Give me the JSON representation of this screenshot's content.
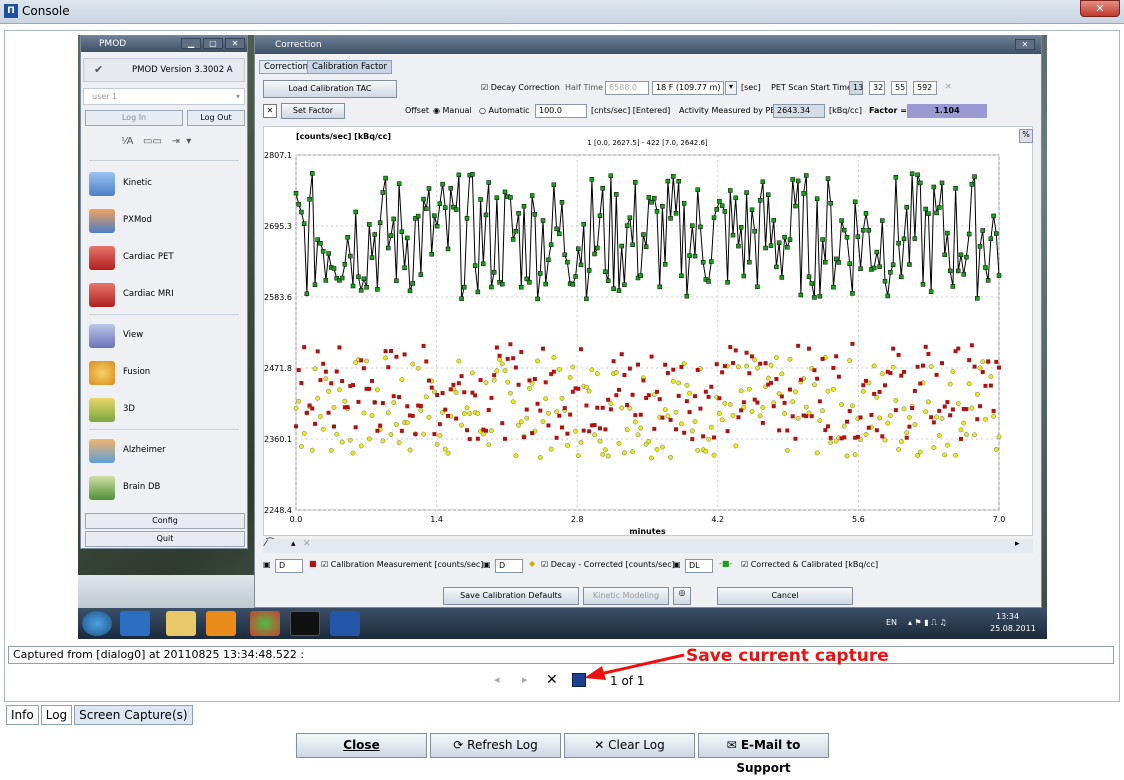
{
  "window": {
    "title": "Console"
  },
  "pmod": {
    "title": "PMOD",
    "version": "PMOD Version 3.3002 A",
    "user_placeholder": "user 1",
    "login": "Log In",
    "logout": "Log Out",
    "tools": [
      "Kinetic",
      "PXMod",
      "Cardiac PET",
      "Cardiac MRI",
      "View",
      "Fusion",
      "3D",
      "Alzheimer",
      "Brain DB"
    ],
    "config": "Config",
    "quit": "Quit"
  },
  "correction": {
    "title": "Correction",
    "tabs": [
      "Correction",
      "Calibration Factor"
    ],
    "load_tac": "Load Calibration TAC",
    "decay_correction": "Decay Correction",
    "half_time_label": "Half Time",
    "half_time_value": "6588.0",
    "isotope": "18 F (109.77 m)",
    "sec": "[sec]",
    "scan_start_label": "PET Scan Start Time",
    "hh": "13",
    "mm": "32",
    "ss": "55",
    "ms": "592",
    "set_factor": "Set Factor",
    "offset_label": "Offset",
    "manual": "Manual",
    "automatic": "Automatic",
    "offset_value": "100.0",
    "offset_unit": "[cnts/sec] [Entered]",
    "activity_label": "Activity Measured by PET",
    "activity_value": "2643.34",
    "activity_unit": "[kBq/cc]",
    "factor_label": "Factor =",
    "factor_value": "1.104",
    "legend": [
      "Calibration Measurement [counts/sec]",
      "Decay - Corrected [counts/sec]",
      "Corrected & Calibrated [kBq/cc]"
    ],
    "legend_d1": "D",
    "legend_d2": "D",
    "legend_d3": "DL",
    "save_defaults": "Save Calibration Defaults",
    "kinetic": "Kinetic Modeling",
    "cancel": "Cancel"
  },
  "chart_data": {
    "type": "scatter",
    "ylabel": "[counts/sec] [kBq/cc]",
    "xlabel": "minutes",
    "annotation": "1 [0.0, 2627.5] - 422 [7.0, 2642.6]",
    "xlim": [
      0.0,
      7.0
    ],
    "ylim": [
      2248.4,
      2807.1
    ],
    "xticks": [
      "0.0",
      "1.4",
      "2.8",
      "4.2",
      "5.6",
      "7.0"
    ],
    "yticks": [
      "2807.1",
      "2695.3",
      "2583.6",
      "2471.8",
      "2360.1",
      "2248.4"
    ],
    "series_colors": {
      "calibration": "#b01212",
      "decay": "#e8e81a",
      "corrected": "#18a018"
    }
  },
  "taskbar": {
    "lang": "EN",
    "time": "13:34",
    "date": "25.08.2011"
  },
  "status": {
    "text": "Captured from [dialog0] at 20110825 13:34:48.522 :"
  },
  "annotation": {
    "text": "Save current capture"
  },
  "nav": {
    "page": "1 of 1"
  },
  "bottom_tabs": [
    "Info",
    "Log",
    "Screen Capture(s)"
  ],
  "buttons": {
    "close": "Close",
    "refresh": "Refresh Log",
    "clear": "Clear Log",
    "email": "E-Mail to Support"
  }
}
